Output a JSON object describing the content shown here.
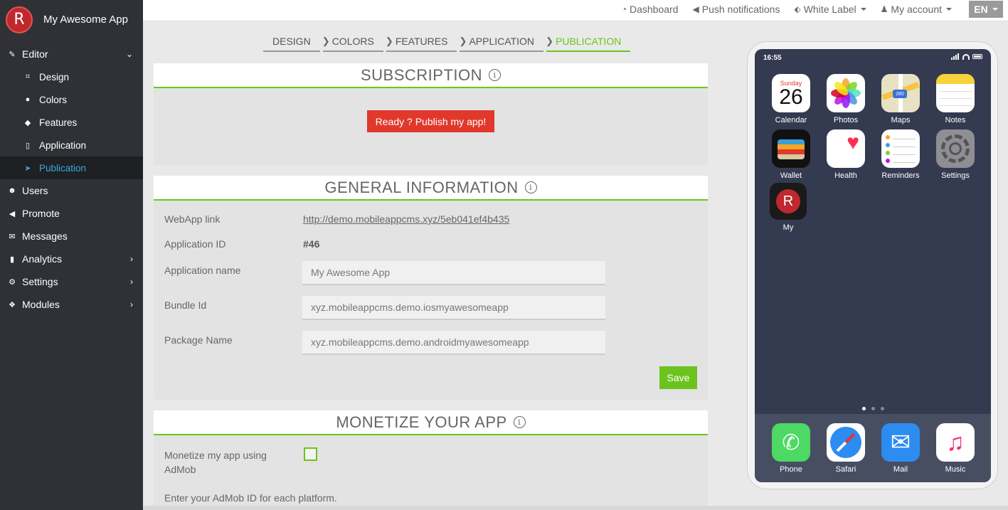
{
  "sidebar": {
    "brand_initial": "R",
    "brand_name": "My Awesome App",
    "items": [
      {
        "label": "Editor",
        "icon": "pencil-icon"
      },
      {
        "label": "Users",
        "icon": "users-icon"
      },
      {
        "label": "Promote",
        "icon": "bullhorn-icon"
      },
      {
        "label": "Messages",
        "icon": "envelope-icon"
      },
      {
        "label": "Analytics",
        "icon": "bar-chart-icon"
      },
      {
        "label": "Settings",
        "icon": "cogs-icon"
      },
      {
        "label": "Modules",
        "icon": "cubes-icon"
      }
    ],
    "editor_sub": [
      {
        "label": "Design",
        "icon": "crop-icon"
      },
      {
        "label": "Colors",
        "icon": "palette-icon"
      },
      {
        "label": "Features",
        "icon": "cube-icon"
      },
      {
        "label": "Application",
        "icon": "mobile-icon"
      },
      {
        "label": "Publication",
        "icon": "paper-plane-icon"
      }
    ]
  },
  "topbar": {
    "dashboard": "Dashboard",
    "push": "Push notifications",
    "white_label": "White Label",
    "account": "My account",
    "lang": "EN"
  },
  "steps": [
    "DESIGN",
    "COLORS",
    "FEATURES",
    "APPLICATION",
    "PUBLICATION"
  ],
  "subscription": {
    "title": "SUBSCRIPTION",
    "publish_button": "Ready ? Publish my app!"
  },
  "general": {
    "title": "GENERAL INFORMATION",
    "webapp_label": "WebApp link",
    "webapp_value": "http://demo.mobileappcms.xyz/5eb041ef4b435",
    "appid_label": "Application ID",
    "appid_value": "#46",
    "appname_label": "Application name",
    "appname_value": "My Awesome App",
    "bundle_label": "Bundle Id",
    "bundle_value": "xyz.mobileappcms.demo.iosmyawesomeapp",
    "package_label": "Package Name",
    "package_value": "xyz.mobileappcms.demo.androidmyawesomeapp",
    "save_button": "Save"
  },
  "monetize": {
    "title": "MONETIZE YOUR APP",
    "checkbox_label_1": "Monetize my app using",
    "checkbox_label_2": "AdMob",
    "admob_hint": "Enter your AdMob ID for each platform."
  },
  "phone": {
    "time": "16:55",
    "calendar_day": "Sunday",
    "calendar_date": "26",
    "maps_sign": "280",
    "apps": [
      "Calendar",
      "Photos",
      "Maps",
      "Notes",
      "Wallet",
      "Health",
      "Reminders",
      "Settings",
      "My"
    ],
    "my_initial": "R",
    "dock": [
      "Phone",
      "Safari",
      "Mail",
      "Music"
    ]
  },
  "colors": {
    "accent_green": "#6dc31e",
    "publish_red": "#e0392b",
    "sidebar_bg": "#2f3136",
    "active_blue": "#3aa7e0"
  }
}
